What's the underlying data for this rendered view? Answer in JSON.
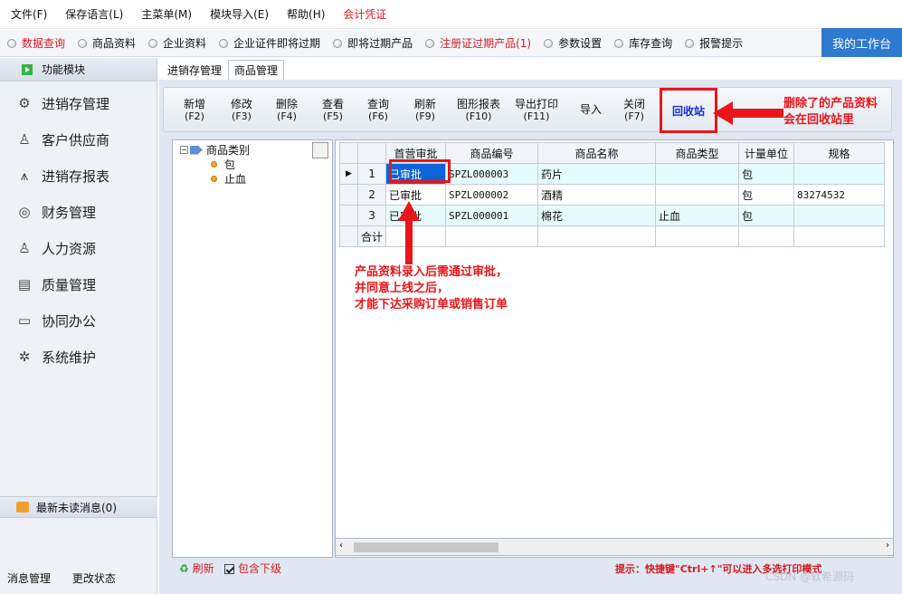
{
  "menu": [
    "文件(F)",
    "保存语言(L)",
    "主菜单(M)",
    "模块导入(E)",
    "帮助(H)",
    "会计凭证"
  ],
  "quick": [
    {
      "label": "数据查询",
      "red": true
    },
    {
      "label": "商品资料",
      "red": false
    },
    {
      "label": "企业资料",
      "red": false
    },
    {
      "label": "企业证件即将过期",
      "red": false
    },
    {
      "label": "即将过期产品",
      "red": false
    },
    {
      "label": "注册证过期产品(1)",
      "red": true
    },
    {
      "label": "参数设置",
      "red": false
    },
    {
      "label": "库存查询",
      "red": false
    },
    {
      "label": "报警提示",
      "red": false
    }
  ],
  "workbench": "我的工作台",
  "sidebar": {
    "header": "功能模块",
    "items": [
      {
        "label": "进销存管理",
        "icon": "gear-badge-icon"
      },
      {
        "label": "客户供应商",
        "icon": "person-icon"
      },
      {
        "label": "进销存报表",
        "icon": "chart-icon"
      },
      {
        "label": "财务管理",
        "icon": "finance-icon"
      },
      {
        "label": "人力资源",
        "icon": "person-icon"
      },
      {
        "label": "质量管理",
        "icon": "document-icon"
      },
      {
        "label": "协同办公",
        "icon": "monitor-icon"
      },
      {
        "label": "系统维护",
        "icon": "settings-icon"
      }
    ],
    "messages": "最新未读消息(0)",
    "bottom": [
      "消息管理",
      "更改状态"
    ]
  },
  "tabs": [
    "进销存管理",
    "商品管理"
  ],
  "toolbar": [
    {
      "label": "新增",
      "key": "(F2)"
    },
    {
      "label": "修改",
      "key": "(F3)"
    },
    {
      "label": "删除",
      "key": "(F4)"
    },
    {
      "label": "查看",
      "key": "(F5)"
    },
    {
      "label": "查询",
      "key": "(F6)"
    },
    {
      "label": "刷新",
      "key": "(F9)"
    },
    {
      "label": "图形报表",
      "key": "(F10)"
    },
    {
      "label": "导出打印",
      "key": "(F11)"
    },
    {
      "label": "导入",
      "key": ""
    },
    {
      "label": "关闭",
      "key": "(F7)"
    }
  ],
  "recycle": "回收站",
  "tree": {
    "root": "商品类别",
    "children": [
      "包",
      "止血"
    ]
  },
  "grid": {
    "columns": [
      "",
      "首营审批",
      "商品编号",
      "商品名称",
      "商品类型",
      "计量单位",
      "规格"
    ],
    "rows": [
      [
        "1",
        "已审批",
        "SPZL000003",
        "药片",
        "",
        "包",
        ""
      ],
      [
        "2",
        "已审批",
        "SPZL000002",
        "酒精",
        "",
        "包",
        "83274532"
      ],
      [
        "3",
        "已审批",
        "SPZL000001",
        "棉花",
        "止血",
        "包",
        ""
      ]
    ],
    "total": "合计"
  },
  "annotations": {
    "recycle_note": [
      "删除了的产品资料",
      "会在回收站里"
    ],
    "approval_note": [
      "产品资料录入后需通过审批，",
      "并同意上线之后，",
      "才能下达采购订单或销售订单"
    ]
  },
  "footer": {
    "refresh": "刷新",
    "include": "包含下级",
    "hint": "提示：快捷键\"Ctrl+↑\"可以进入多选打印模式"
  },
  "watermark": "CSDN @软希源码"
}
